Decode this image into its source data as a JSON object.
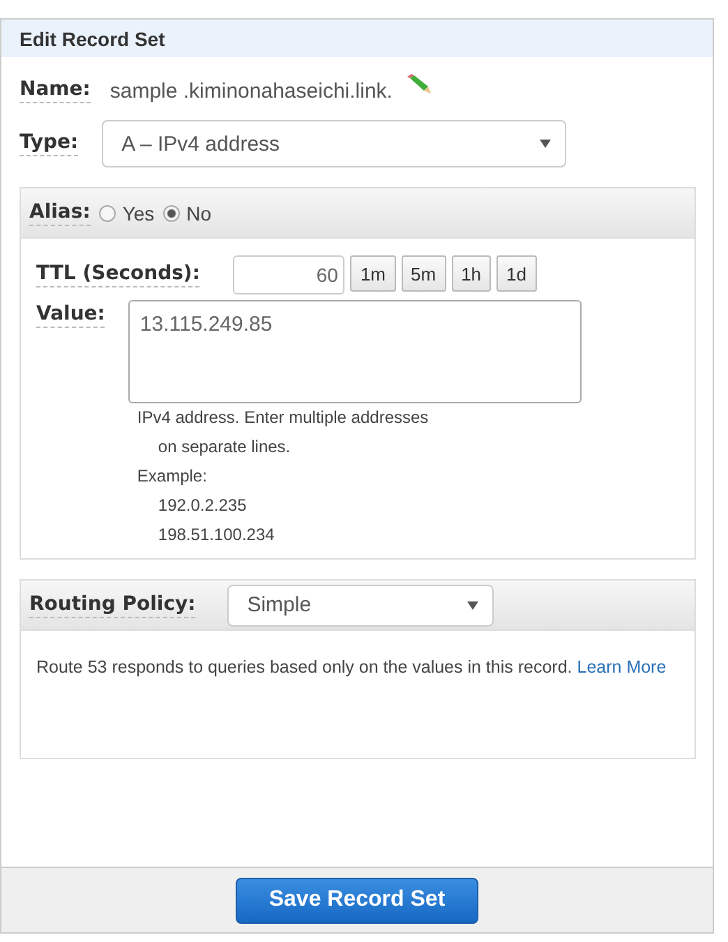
{
  "panel": {
    "title": "Edit Record Set"
  },
  "name": {
    "label": "Name:",
    "value": "sample .kiminonahaseichi.link."
  },
  "type": {
    "label": "Type:",
    "value": "A – IPv4 address"
  },
  "alias": {
    "label": "Alias:",
    "options": [
      {
        "label": "Yes",
        "selected": false
      },
      {
        "label": "No",
        "selected": true
      }
    ]
  },
  "ttl": {
    "label": "TTL (Seconds):",
    "value": "60",
    "presets": [
      "1m",
      "5m",
      "1h",
      "1d"
    ]
  },
  "value": {
    "label": "Value:",
    "text": "13.115.249.85",
    "help": [
      {
        "text": "IPv4 address. Enter multiple addresses",
        "indented": false
      },
      {
        "text": "on separate lines.",
        "indented": true
      },
      {
        "text": "Example:",
        "indented": false
      },
      {
        "text": "192.0.2.235",
        "indented": true
      },
      {
        "text": "198.51.100.234",
        "indented": true
      }
    ]
  },
  "routing": {
    "label": "Routing Policy:",
    "value": "Simple",
    "description": "Route 53 responds to queries based only on the values in this record.",
    "link": "Learn More"
  },
  "save_button": "Save Record Set"
}
